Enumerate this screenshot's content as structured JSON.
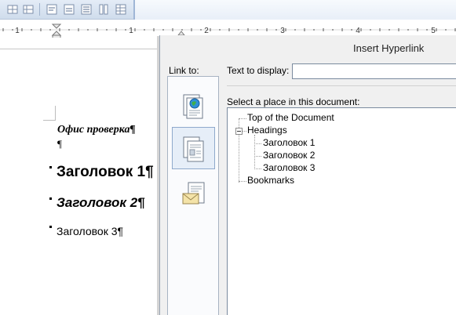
{
  "toolbar": {
    "icons": [
      "borders-icon",
      "table-grid-icon",
      "align-left-icon",
      "align-center-icon",
      "column-layout-icon",
      "table-insert-icon"
    ]
  },
  "ruler": {
    "numbers": [
      "1",
      "1",
      "2",
      "3",
      "4",
      "5"
    ]
  },
  "document": {
    "lines": [
      "Офис проверка¶",
      "¶",
      "Заголовок 1¶",
      "Заголовок 2¶",
      "Заголовок 3¶"
    ]
  },
  "dialog": {
    "title": "Insert Hyperlink",
    "link_to_label": "Link to:",
    "link_to_options": [
      "existing-file-or-web-page-icon",
      "place-in-this-document-icon",
      "email-address-icon"
    ],
    "text_to_display_label": "Text to display:",
    "text_to_display_value": "",
    "select_place_label": "Select a place in this document:",
    "tree": {
      "top": "Top of the Document",
      "headings": "Headings",
      "heading_items": [
        "Заголовок 1",
        "Заголовок 2",
        "Заголовок 3"
      ],
      "bookmarks": "Bookmarks"
    }
  }
}
